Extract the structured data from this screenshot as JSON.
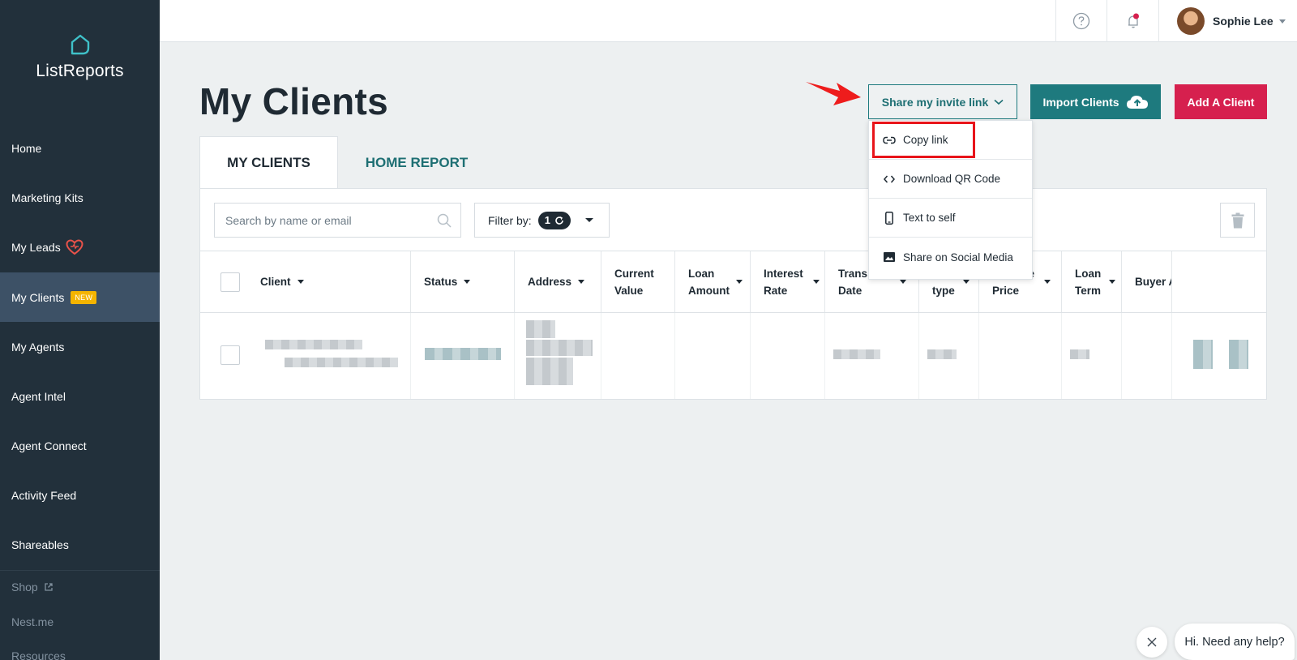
{
  "brand": {
    "name": "ListReports",
    "accent": "#1e7a7e",
    "danger": "#d6204e",
    "sidebar_bg": "#22303b"
  },
  "sidebar": {
    "items": [
      {
        "label": "Home"
      },
      {
        "label": "Marketing Kits"
      },
      {
        "label": "My Leads",
        "icon": "heart-icon"
      },
      {
        "label": "My Clients",
        "badge": "NEW",
        "active": true
      },
      {
        "label": "My Agents"
      },
      {
        "label": "Agent Intel"
      },
      {
        "label": "Agent Connect"
      },
      {
        "label": "Activity Feed"
      },
      {
        "label": "Shareables"
      }
    ],
    "secondary": [
      {
        "label": "Shop",
        "icon": "external-link-icon"
      },
      {
        "label": "Nest.me"
      },
      {
        "label": "Resources"
      }
    ]
  },
  "topbar": {
    "user_name": "Sophie Lee",
    "icons": [
      "help-icon",
      "bell-icon"
    ]
  },
  "main": {
    "title": "My Clients",
    "share_button": "Share my invite link",
    "import_button": "Import Clients",
    "add_button": "Add A Client",
    "tabs": [
      {
        "label": "MY CLIENTS",
        "active": true
      },
      {
        "label": "HOME REPORT"
      }
    ],
    "search_placeholder": "Search by name or email",
    "filter_label": "Filter by:",
    "filter_count": "1",
    "columns": [
      [
        "Client"
      ],
      [
        "Status"
      ],
      [
        "Address"
      ],
      [
        "Current",
        "Value"
      ],
      [
        "Loan",
        "Amount"
      ],
      [
        "Interest",
        "Rate"
      ],
      [
        "Trans",
        "Date"
      ],
      [
        "",
        "type"
      ],
      [
        "se",
        "Price"
      ],
      [
        "Loan",
        "Term"
      ],
      [
        "Buyer A"
      ]
    ]
  },
  "share_menu": {
    "items": [
      {
        "label": "Copy link",
        "icon": "link-icon"
      },
      {
        "label": "Download QR Code",
        "icon": "code-icon"
      },
      {
        "label": "Text to self",
        "icon": "phone-icon"
      },
      {
        "label": "Share on Social Media",
        "icon": "image-icon"
      }
    ]
  },
  "chat": {
    "message": "Hi. Need any help?"
  }
}
